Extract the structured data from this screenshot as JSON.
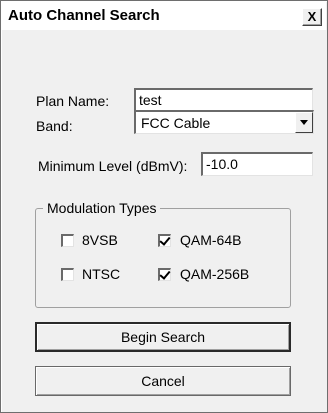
{
  "window": {
    "title": "Auto Channel Search",
    "close_glyph": "X"
  },
  "form": {
    "plan_name_label": "Plan Name:",
    "plan_name_value": "test",
    "band_label": "Band:",
    "band_value": "FCC Cable",
    "min_level_label": "Minimum Level (dBmV):",
    "min_level_value": "-10.0"
  },
  "modulation": {
    "group_title": "Modulation Types",
    "options": [
      {
        "label": "8VSB",
        "checked": false
      },
      {
        "label": "QAM-64B",
        "checked": true
      },
      {
        "label": "NTSC",
        "checked": false
      },
      {
        "label": "QAM-256B",
        "checked": true
      }
    ]
  },
  "buttons": {
    "begin_search": "Begin Search",
    "cancel": "Cancel"
  }
}
